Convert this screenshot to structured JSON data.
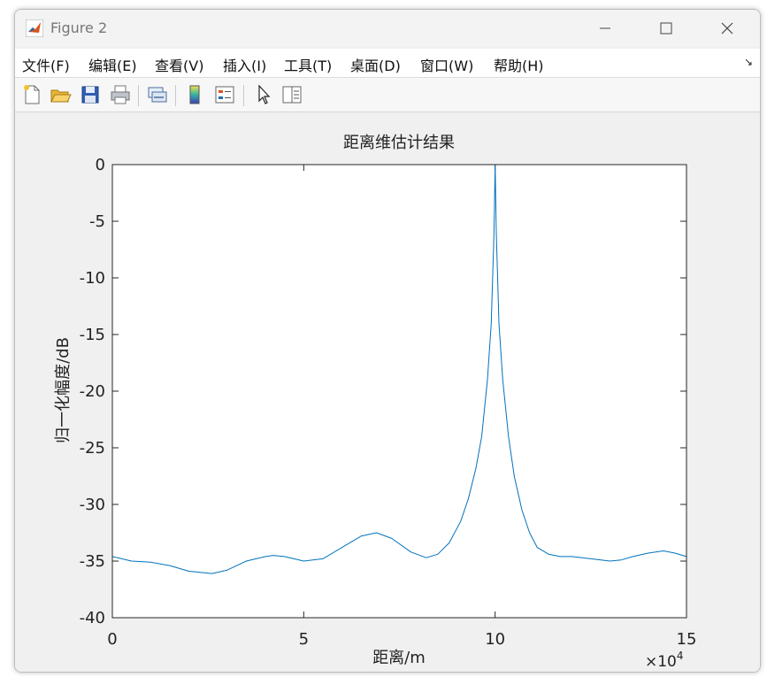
{
  "window": {
    "title": "Figure 2"
  },
  "menu": {
    "items": [
      "文件(F)",
      "编辑(E)",
      "查看(V)",
      "插入(I)",
      "工具(T)",
      "桌面(D)",
      "窗口(W)",
      "帮助(H)"
    ],
    "dock_glyph": "↘"
  },
  "toolbar": {
    "icons": [
      "new-figure-icon",
      "open-file-icon",
      "save-icon",
      "print-icon",
      "link-icon",
      "colorbar-icon",
      "legend-icon",
      "pointer-icon",
      "property-editor-icon"
    ]
  },
  "chart_data": {
    "type": "line",
    "title": "距离维估计结果",
    "xlabel": "距离/m",
    "ylabel": "归一化幅度/dB",
    "x_exponent_label": "×10",
    "x_exponent": "4",
    "xlim": [
      0,
      15
    ],
    "ylim": [
      -40,
      0
    ],
    "xticks": [
      "0",
      "5",
      "10",
      "15"
    ],
    "yticks": [
      "0",
      "-5",
      "-10",
      "-15",
      "-20",
      "-25",
      "-30",
      "-35",
      "-40"
    ],
    "line_color": "#0072bd",
    "grid": false,
    "series": [
      {
        "x": [
          0,
          0.5,
          1.0,
          1.5,
          2.0,
          2.3,
          2.6,
          3.0,
          3.5,
          4.0,
          4.2,
          4.5,
          5.0,
          5.5,
          6.0,
          6.5,
          6.9,
          7.3,
          7.8,
          8.2,
          8.5,
          8.8,
          9.1,
          9.3,
          9.5,
          9.65,
          9.8,
          9.9,
          9.97,
          10.0,
          10.03,
          10.1,
          10.2,
          10.35,
          10.5,
          10.7,
          10.9,
          11.1,
          11.4,
          11.7,
          12.0,
          12.5,
          13.0,
          13.3,
          13.6,
          14.0,
          14.4,
          14.7,
          15.0
        ],
        "y": [
          -34.6,
          -35.0,
          -35.1,
          -35.4,
          -35.9,
          -36.0,
          -36.1,
          -35.8,
          -35.0,
          -34.6,
          -34.5,
          -34.6,
          -35.0,
          -34.8,
          -33.8,
          -32.8,
          -32.5,
          -33.0,
          -34.2,
          -34.7,
          -34.4,
          -33.4,
          -31.5,
          -29.5,
          -26.8,
          -24.0,
          -19.0,
          -14.0,
          -6.0,
          0,
          -6.0,
          -14.0,
          -19.0,
          -24.0,
          -27.5,
          -30.5,
          -32.5,
          -33.8,
          -34.4,
          -34.6,
          -34.6,
          -34.8,
          -35.0,
          -34.9,
          -34.6,
          -34.3,
          -34.1,
          -34.3,
          -34.6
        ]
      }
    ]
  }
}
